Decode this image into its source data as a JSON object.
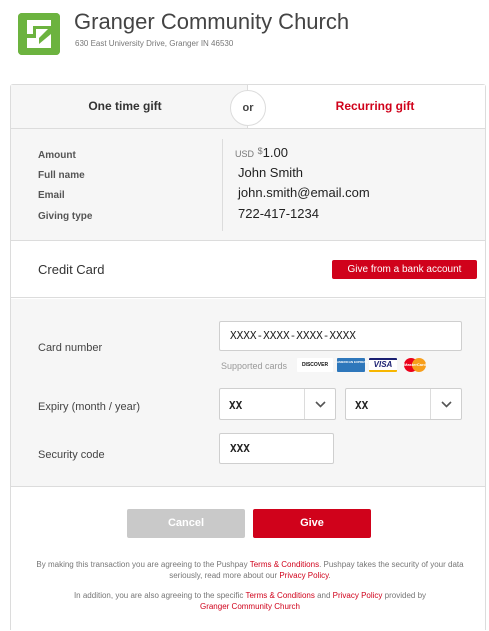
{
  "header": {
    "church_name": "Granger Community Church",
    "address": "630 East University Drive, Granger IN 46530",
    "logo_icon": "church-logo-icon"
  },
  "tabs": {
    "one_time": "One time gift",
    "or": "or",
    "recurring": "Recurring gift"
  },
  "summary": {
    "amount_label": "Amount",
    "full_name_label": "Full name",
    "email_label": "Email",
    "giving_type_label": "Giving type",
    "amount_currency": "USD",
    "amount_symbol": "$",
    "amount_value": "1.00",
    "full_name": "John Smith",
    "email": "john.smith@email.com",
    "giving_type": "722-417-1234"
  },
  "payment": {
    "method_title": "Credit Card",
    "bank_button": "Give from a bank account"
  },
  "card": {
    "number_label": "Card number",
    "number_value": "XXXX-XXXX-XXXX-XXXX",
    "supported_label": "Supported cards",
    "brands": [
      "DISCOVER",
      "AMERICAN EXPRESS",
      "VISA",
      "MasterCard"
    ],
    "expiry_label": "Expiry (month / year)",
    "expiry_month": "XX",
    "expiry_year": "XX",
    "security_label": "Security code",
    "security_value": "XXX"
  },
  "actions": {
    "cancel": "Cancel",
    "give": "Give"
  },
  "legal": {
    "p1_a": "By making this transaction you are agreeing to the Pushpay ",
    "p1_terms": "Terms & Conditions",
    "p1_b": ". Pushpay takes the security of your data seriously, read more about our ",
    "p1_privacy": "Privacy Policy",
    "p1_c": ".",
    "p2_a": "In addition, you are also agreeing to the specific ",
    "p2_terms": "Terms & Conditions",
    "p2_b": " and ",
    "p2_privacy": "Privacy Policy",
    "p2_c": " provided by ",
    "p2_church": "Granger Community Church"
  },
  "colors": {
    "accent": "#d0021b",
    "logo": "#6cb33f",
    "panel_bg": "#f6f6f6",
    "border": "#dcdcdc"
  }
}
